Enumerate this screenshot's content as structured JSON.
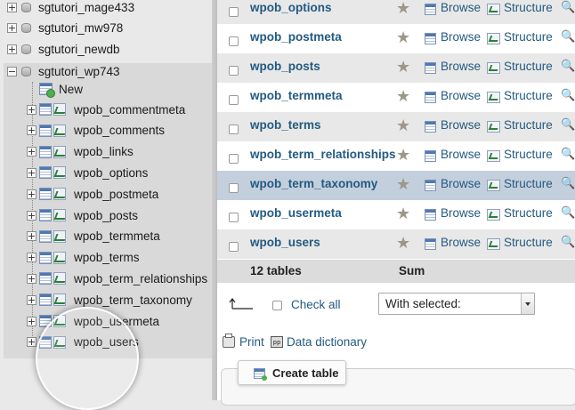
{
  "navigation": {
    "databases_above": [
      {
        "label": "sgtutori_mage433",
        "expander": "+"
      },
      {
        "label": "sgtutori_mw978",
        "expander": "+"
      },
      {
        "label": "sgtutori_newdb",
        "expander": "+"
      }
    ],
    "open_database": {
      "label": "sgtutori_wp743",
      "expander": "−"
    },
    "new_label": "New",
    "tables": [
      "wpob_commentmeta",
      "wpob_comments",
      "wpob_links",
      "wpob_options",
      "wpob_postmeta",
      "wpob_posts",
      "wpob_termmeta",
      "wpob_terms",
      "wpob_term_relationships",
      "wpob_term_taxonomy",
      "wpob_usermeta",
      "wpob_users"
    ],
    "expander_plus": "+"
  },
  "table_list": {
    "rows": [
      {
        "name": "wpob_options"
      },
      {
        "name": "wpob_postmeta"
      },
      {
        "name": "wpob_posts"
      },
      {
        "name": "wpob_termmeta"
      },
      {
        "name": "wpob_terms"
      },
      {
        "name": "wpob_term_relationships"
      },
      {
        "name": "wpob_term_taxonomy"
      },
      {
        "name": "wpob_usermeta"
      },
      {
        "name": "wpob_users"
      }
    ],
    "highlighted_row": "wpob_term_taxonomy",
    "browse_label": "Browse",
    "structure_label": "Structure",
    "favorite_glyph": "★",
    "search_glyph": "🔍",
    "summary": {
      "count_label": "12 tables",
      "sum_label": "Sum"
    }
  },
  "actions": {
    "check_all_label": "Check all",
    "with_selected_value": "With selected:",
    "print_label": "Print",
    "data_dictionary_label": "Data dictionary",
    "dictionary_icon_text": "pp",
    "create_table_label": "Create table"
  },
  "colors": {
    "link": "#235a81",
    "highlight_row": "#c4cfdd",
    "even_row": "#e8e8e8",
    "nav_background": "#e9e9e9"
  }
}
